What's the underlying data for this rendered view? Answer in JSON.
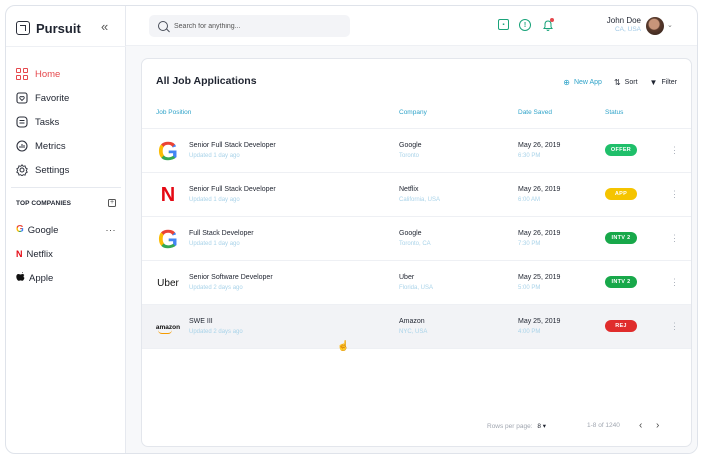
{
  "brand": {
    "name": "Pursuit",
    "logo_icon": "app-logo-icon",
    "collapse": "«"
  },
  "nav": [
    {
      "label": "Home",
      "icon": "home-grid-icon",
      "active": true
    },
    {
      "label": "Favorite",
      "icon": "favorite-icon"
    },
    {
      "label": "Tasks",
      "icon": "tasks-icon"
    },
    {
      "label": "Metrics",
      "icon": "metrics-icon"
    },
    {
      "label": "Settings",
      "icon": "settings-gear-icon"
    }
  ],
  "top_companies": {
    "heading": "TOP COMPANIES",
    "add": "+",
    "items": [
      {
        "label": "Google",
        "icon": "google-icon",
        "more": "···"
      },
      {
        "label": "Netflix",
        "icon": "netflix-icon"
      },
      {
        "label": "Apple",
        "icon": "apple-icon"
      }
    ]
  },
  "search": {
    "placeholder": "Search for anything..."
  },
  "user": {
    "name": "John Doe",
    "location": "CA, USA"
  },
  "card": {
    "title": "All Job Applications",
    "actions": {
      "new_app": "New App",
      "sort": "Sort",
      "filter": "Filter"
    },
    "columns": {
      "position": "Job Position",
      "company": "Company",
      "date": "Date Saved",
      "status": "Status"
    },
    "rows": [
      {
        "logo": "G",
        "position": "Senior Full Stack Developer",
        "updated": "Updated 1 day ago",
        "company": "Google",
        "location": "Toronto",
        "date": "May 26, 2019",
        "time": "6:30 PM",
        "status": "OFFER",
        "status_color": "#1fbf6a"
      },
      {
        "logo": "N",
        "position": "Senior Full Stack Developer",
        "updated": "Updated 1 day ago",
        "company": "Netflix",
        "location": "California, USA",
        "date": "May 26, 2019",
        "time": "6:00 AM",
        "status": "APP",
        "status_color": "#f5c400"
      },
      {
        "logo": "G",
        "position": "Full Stack Developer",
        "updated": "Updated 1 day ago",
        "company": "Google",
        "location": "Toronto, CA",
        "date": "May 26, 2019",
        "time": "7:30 PM",
        "status": "INTV 2",
        "status_color": "#18a84a"
      },
      {
        "logo": "Uber",
        "position": "Senior Software Developer",
        "updated": "Updated 2 days ago",
        "company": "Uber",
        "location": "Florida, USA",
        "date": "May 25, 2019",
        "time": "5:00 PM",
        "status": "INTV 2",
        "status_color": "#18a84a"
      },
      {
        "logo": "amazon",
        "position": "SWE III",
        "updated": "Updated 2 days ago",
        "company": "Amazon",
        "location": "NYC, USA",
        "date": "May 25, 2019",
        "time": "4:00 PM",
        "status": "REJ",
        "status_color": "#e02c2c"
      }
    ],
    "footer": {
      "rows_per_page_label": "Rows per page:",
      "rows_per_page": "8 ▾",
      "range": "1-8 of 1240",
      "prev": "‹",
      "next": "›"
    }
  }
}
